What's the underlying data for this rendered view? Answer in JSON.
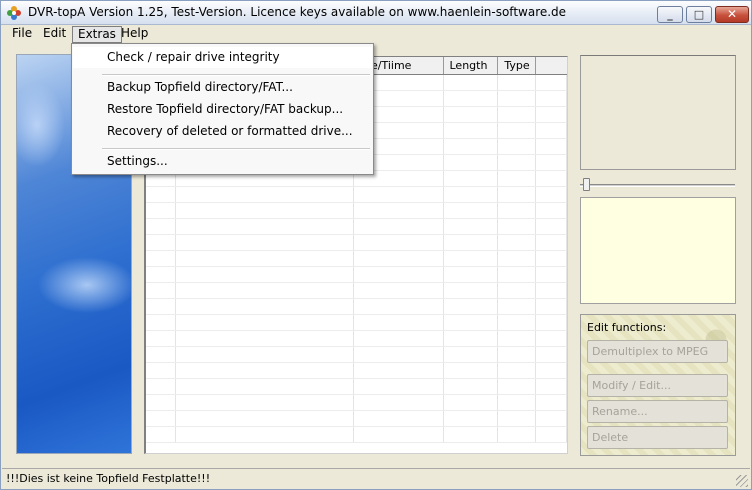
{
  "window": {
    "title": "DVR-topA Version 1.25, Test-Version. Licence keys available on www.haenlein-software.de",
    "minimize_glyph": "_",
    "maximize_glyph": "□",
    "close_glyph": "✕"
  },
  "menubar": {
    "items": [
      {
        "label": "File"
      },
      {
        "label": "Edit"
      },
      {
        "label": "Extras"
      },
      {
        "label": "Help"
      }
    ]
  },
  "extras_menu": {
    "items": [
      {
        "label": "Check / repair drive integrity"
      },
      {
        "label": "Backup Topfield directory/FAT..."
      },
      {
        "label": "Restore Topfield directory/FAT backup..."
      },
      {
        "label": "Recovery of deleted or formatted drive..."
      },
      {
        "label": "Settings..."
      }
    ]
  },
  "filelist": {
    "columns": [
      {
        "label": ""
      },
      {
        "label": ""
      },
      {
        "label": "ate/Tiime"
      },
      {
        "label": "Length"
      },
      {
        "label": "Type"
      }
    ]
  },
  "edit_panel": {
    "label": "Edit functions:",
    "buttons": [
      {
        "label": "Demultiplex to MPEG"
      },
      {
        "label": "Modify / Edit..."
      },
      {
        "label": "Rename..."
      },
      {
        "label": "Delete"
      }
    ]
  },
  "statusbar": {
    "text": "!!!Dies ist keine Topfield Festplatte!!!"
  },
  "icons": {
    "app": "app-flower-icon",
    "grip": "resize-grip-icon"
  },
  "colors": {
    "info_panel": "#ffffe1",
    "banner_blue": "#2d6ecf",
    "close_button": "#c7513c"
  }
}
